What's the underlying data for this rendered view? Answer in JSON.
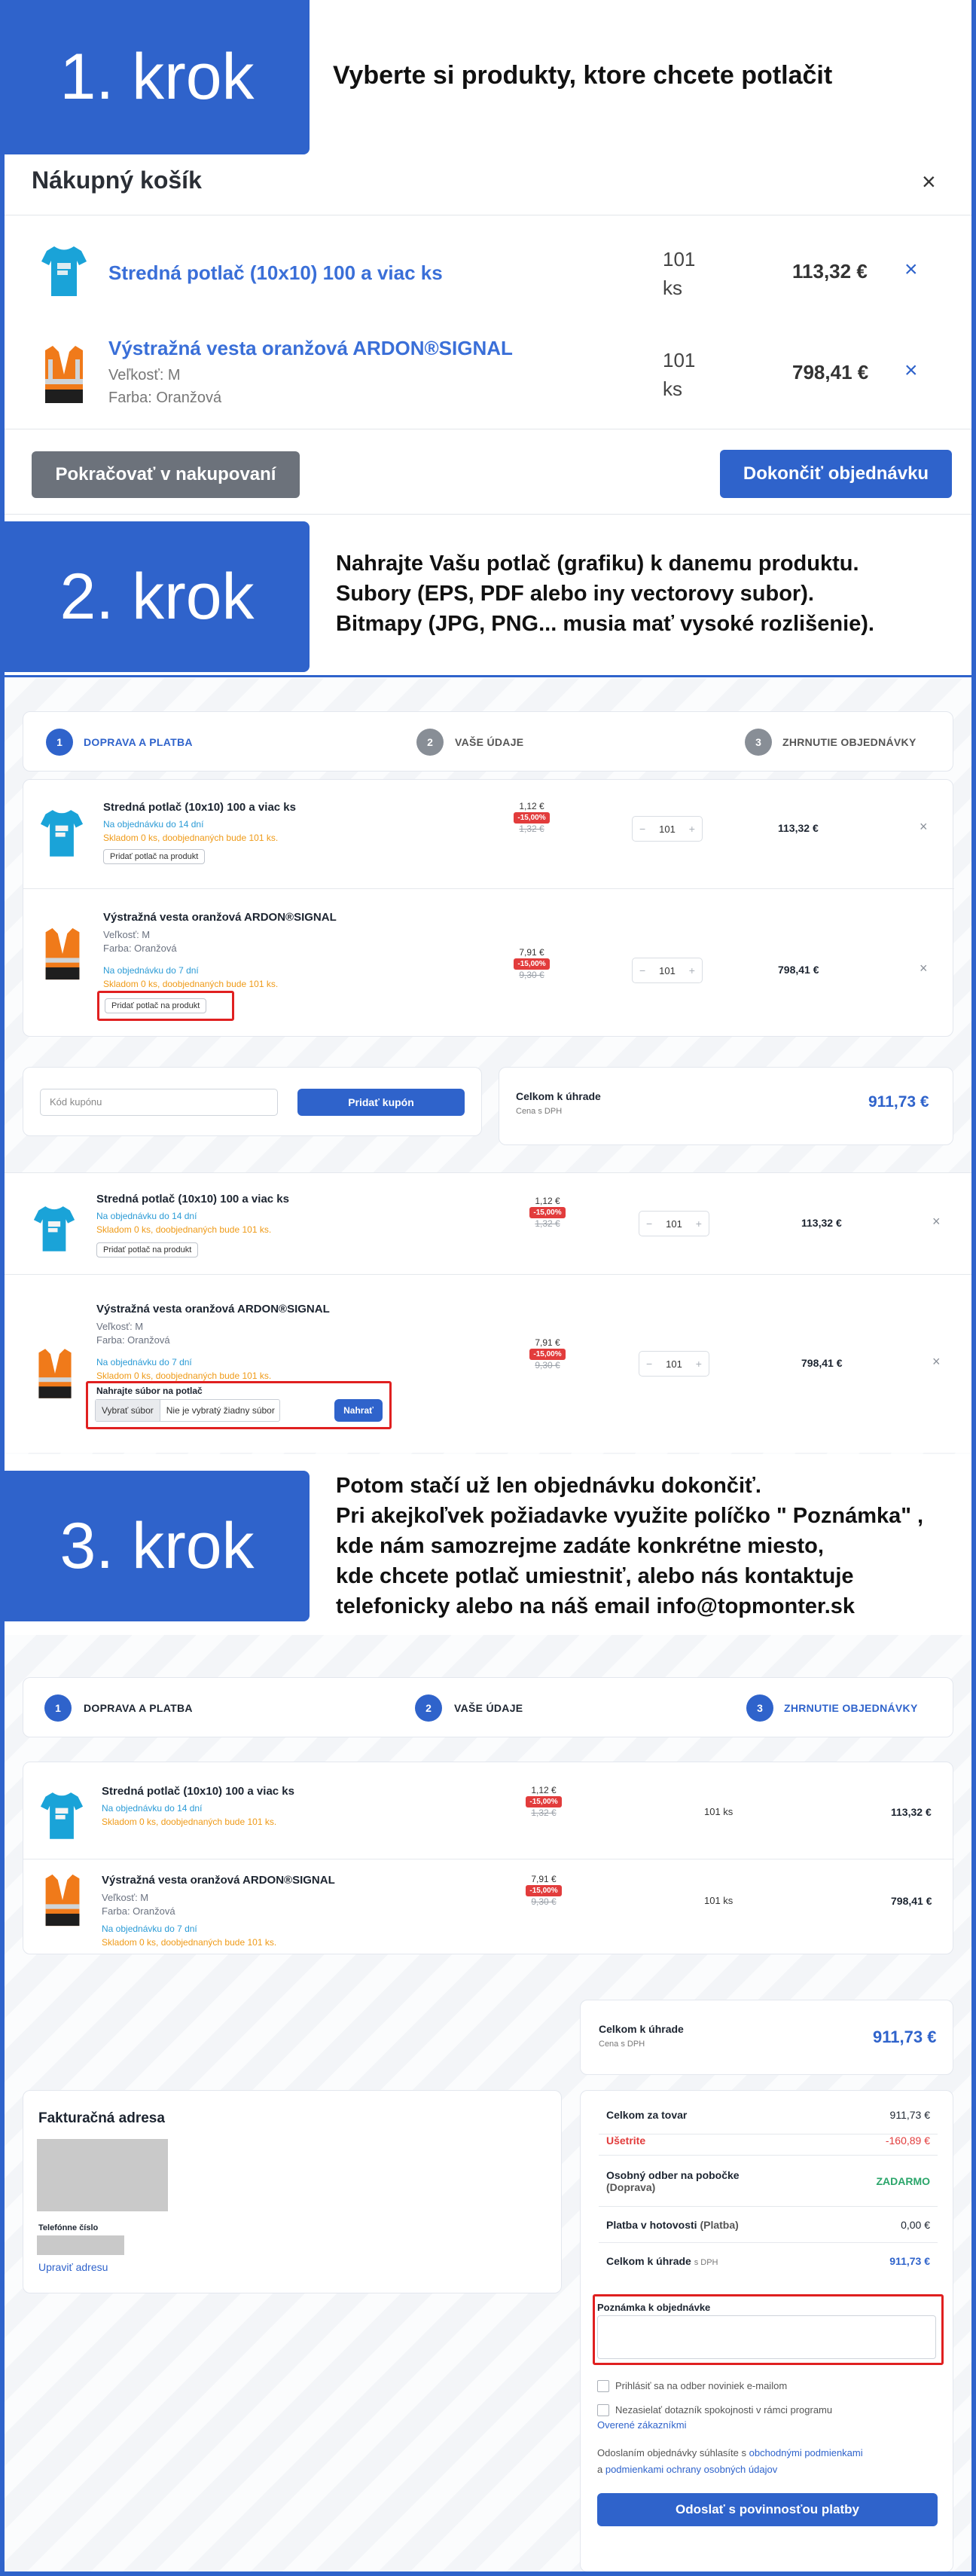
{
  "step1": {
    "label": "1. krok",
    "text": "Vyberte si produkty, ktore chcete potlačit"
  },
  "cart": {
    "title": "Nákupný košík",
    "items": [
      {
        "name": "Stredná potlač (10x10) 100 a viac ks",
        "qty": "101",
        "qty_unit": "ks",
        "total": "113,32 €"
      },
      {
        "name": "Výstražná vesta oranžová ARDON®SIGNAL",
        "size": "Veľkosť: M",
        "color": "Farba: Oranžová",
        "qty": "101",
        "qty_unit": "ks",
        "total": "798,41 €"
      }
    ],
    "continue_label": "Pokračovať v nakupovaní",
    "checkout_label": "Dokončiť objednávku"
  },
  "step2": {
    "label": "2. krok",
    "lines": [
      "Nahrajte Vašu potlač (grafiku) k danemu produktu.",
      "Subory (EPS, PDF alebo iny vectorovy subor).",
      "Bitmapy (JPG, PNG... musia mať vysoké rozlišenie)."
    ]
  },
  "checkout_steps": [
    {
      "num": "1",
      "label": "DOPRAVA A PLATBA"
    },
    {
      "num": "2",
      "label": "VAŠE ÚDAJE"
    },
    {
      "num": "3",
      "label": "ZHRNUTIE OBJEDNÁVKY"
    }
  ],
  "order_items": [
    {
      "name": "Stredná potlač (10x10) 100 a viac ks",
      "availability": "Na objednávku do 14 dní",
      "stock": "Skladom 0 ks, doobjednaných bude 101 ks.",
      "unit_price": "1,12 €",
      "discount": "-15,00%",
      "old_price": "1,32 €",
      "qty": "101",
      "total": "113,32 €",
      "add_print": "Pridať potlač na produkt"
    },
    {
      "name": "Výstražná vesta oranžová ARDON®SIGNAL",
      "size": "Veľkosť: M",
      "color": "Farba: Oranžová",
      "availability": "Na objednávku do 7 dní",
      "stock": "Skladom 0 ks, doobjednaných bude 101 ks.",
      "unit_price": "7,91 €",
      "discount": "-15,00%",
      "old_price": "9,30 €",
      "qty": "101",
      "total": "798,41 €",
      "add_print": "Pridať potlač na produkt"
    }
  ],
  "coupon": {
    "placeholder": "Kód kupónu",
    "button": "Pridať kupón"
  },
  "grand_total": {
    "label": "Celkom k úhrade",
    "sub": "Cena s DPH",
    "value": "911,73 €"
  },
  "upload": {
    "title": "Nahrajte súbor na potlač",
    "choose": "Vybrať súbor",
    "none": "Nie je vybratý žiadny súbor",
    "submit": "Nahrať"
  },
  "step3": {
    "label": "3. krok",
    "lines": [
      "Potom stačí už len objednávku dokončiť.",
      "Pri akejkoľvek požiadavke využite políčko \" Poznámka\" ,",
      "kde nám samozrejme zadáte konkrétne miesto,",
      "kde chcete potlač umiestniť, alebo nás kontaktuje",
      "telefonicky alebo na náš email info@topmonter.sk"
    ]
  },
  "summary_qty": "101 ks",
  "billing": {
    "title": "Fakturačná adresa",
    "phone_label": "Telefónne číslo",
    "edit": "Upraviť adresu"
  },
  "summary": {
    "goods_label": "Celkom za tovar",
    "goods_value": "911,73 €",
    "saved_label": "Ušetrite",
    "saved_value": "-160,89 €",
    "pickup_label": "Osobný odber na pobočke",
    "pickup_sub": "(Doprava)",
    "pickup_value": "ZADARMO",
    "cash_label": "Platba v hotovosti",
    "cash_sub": "(Platba)",
    "cash_value": "0,00 €",
    "total_label": "Celkom k úhrade",
    "total_sub": "s DPH",
    "total_value": "911,73 €"
  },
  "note": {
    "label": "Poznámka k objednávke"
  },
  "newsletter": "Prihlásiť sa na odber noviniek e-mailom",
  "survey_a": "Nezasielať dotazník spokojnosti v rámci programu",
  "survey_b": "Overené zákazníkmi",
  "terms": {
    "a": "Odoslaním objednávky súhlasíte s ",
    "b": "obchodnými podmienkami",
    "c": "a ",
    "d": "podmienkami ochrany osobných údajov"
  },
  "submit": "Odoslať s povinnosťou platby",
  "colors": {
    "accent": "#2f63cb",
    "discount": "#e23c3c",
    "availability": "#2b9bd6",
    "stock": "#ef9a17",
    "highlight": "#e02020"
  }
}
